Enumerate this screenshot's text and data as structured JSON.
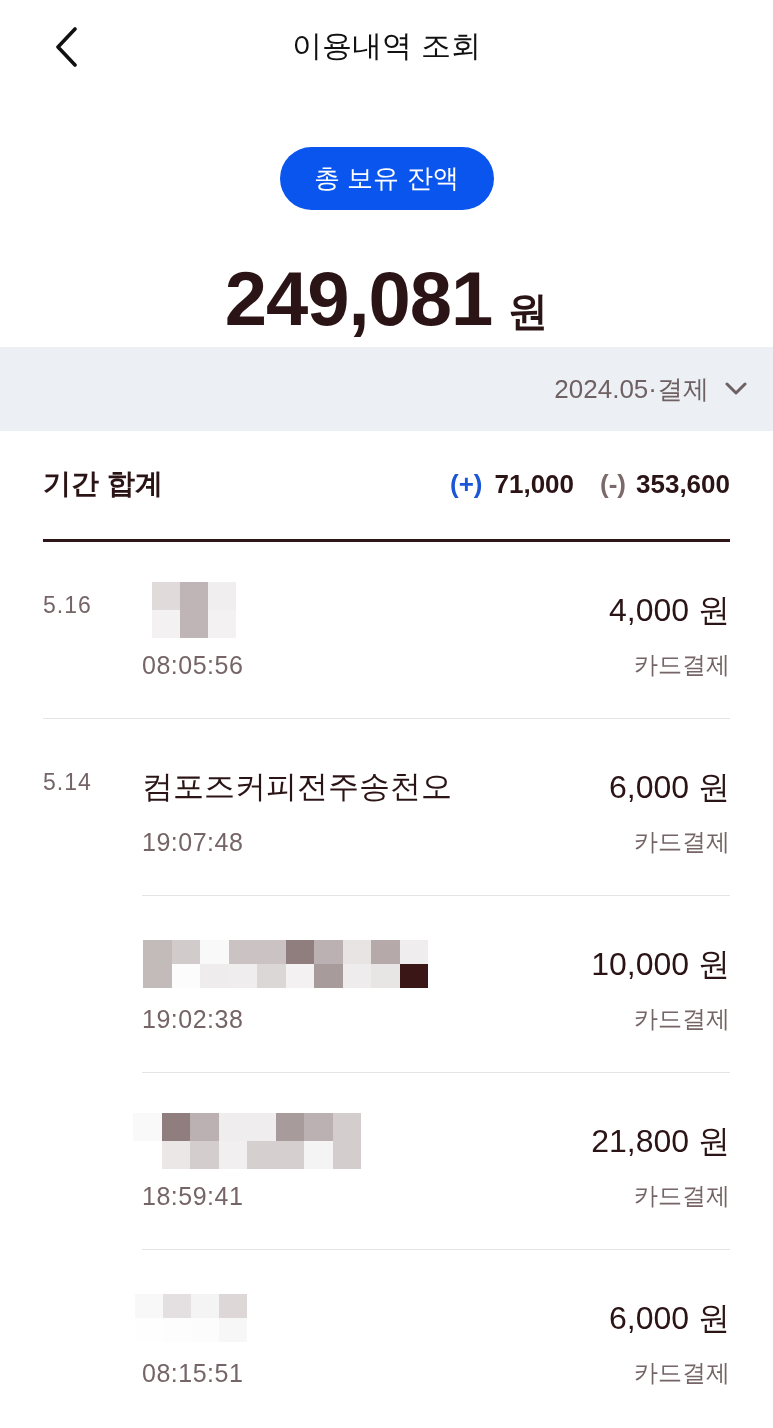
{
  "header": {
    "title": "이용내역 조회"
  },
  "balance": {
    "label": "총 보유 잔액",
    "amount": "249,081",
    "unit": "원"
  },
  "filter": {
    "value": "2024.05·결제"
  },
  "summary": {
    "label": "기간 합계",
    "income": {
      "sign": "(+)",
      "amount": "71,000"
    },
    "expense": {
      "sign": "(-)",
      "amount": "353,600"
    }
  },
  "groups": [
    {
      "date": "5.16",
      "items": [
        {
          "kind": "redacted",
          "time": "08:05:56",
          "amount": "4,000 원",
          "method": "카드결제"
        }
      ]
    },
    {
      "date": "5.14",
      "items": [
        {
          "kind": "text",
          "name": "컴포즈커피전주송천오",
          "time": "19:07:48",
          "amount": "6,000 원",
          "method": "카드결제"
        },
        {
          "kind": "redacted",
          "time": "19:02:38",
          "amount": "10,000 원",
          "method": "카드결제"
        },
        {
          "kind": "redacted",
          "time": "18:59:41",
          "amount": "21,800 원",
          "method": "카드결제"
        },
        {
          "kind": "redacted",
          "time": "08:15:51",
          "amount": "6,000 원",
          "method": "카드결제"
        }
      ]
    }
  ]
}
